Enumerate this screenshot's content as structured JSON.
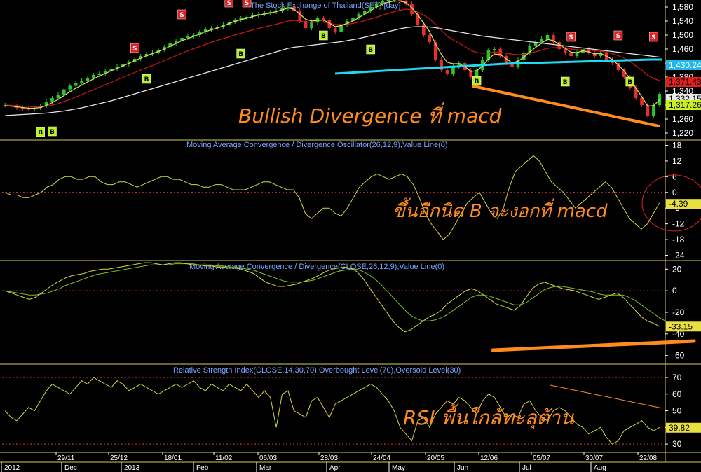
{
  "chart_data": [
    {
      "type": "candlestick",
      "title": "The Stock Exchange of Thailand(SET) [day]",
      "ylim": [
        1200,
        1600
      ],
      "yticks": [
        "1,580",
        "1,540",
        "1,500",
        "1,460",
        "1,420",
        "1,380",
        "1,340",
        "1,300",
        "1,260",
        "1,220"
      ],
      "price_badges": [
        {
          "value": "1,430.24",
          "color": "#20b8e8"
        },
        {
          "value": "1,371.43",
          "color": "#e02020"
        },
        {
          "value": "1,332.15",
          "color": "#e8e8e8"
        },
        {
          "value": "1,317.26",
          "color": "#c8f020"
        }
      ],
      "close": [
        1300,
        1296,
        1292,
        1290,
        1288,
        1292,
        1298,
        1310,
        1320,
        1330,
        1345,
        1355,
        1362,
        1370,
        1378,
        1386,
        1390,
        1396,
        1404,
        1410,
        1416,
        1424,
        1432,
        1440,
        1446,
        1450,
        1458,
        1466,
        1476,
        1484,
        1492,
        1496,
        1500,
        1508,
        1516,
        1520,
        1524,
        1530,
        1538,
        1544,
        1548,
        1552,
        1556,
        1560,
        1562,
        1566,
        1570,
        1576,
        1580,
        1570,
        1540,
        1520,
        1536,
        1548,
        1544,
        1520,
        1510,
        1530,
        1540,
        1548,
        1560,
        1570,
        1580,
        1590,
        1596,
        1600,
        1600,
        1598,
        1590,
        1560,
        1530,
        1500,
        1480,
        1430,
        1400,
        1390,
        1410,
        1420,
        1400,
        1380,
        1400,
        1430,
        1456,
        1460,
        1440,
        1420,
        1410,
        1430,
        1450,
        1470,
        1480,
        1490,
        1500,
        1480,
        1460,
        1450,
        1440,
        1450,
        1460,
        1450,
        1440,
        1450,
        1430,
        1420,
        1400,
        1380,
        1350,
        1320,
        1300,
        1270,
        1300,
        1332
      ],
      "ma_fast": [
        1298,
        1297,
        1295,
        1293,
        1291,
        1291,
        1293,
        1299,
        1307,
        1316,
        1327,
        1338,
        1348,
        1357,
        1366,
        1375,
        1383,
        1390,
        1398,
        1405,
        1412,
        1419,
        1427,
        1434,
        1441,
        1447,
        1453,
        1460,
        1468,
        1476,
        1484,
        1490,
        1496,
        1503,
        1510,
        1515,
        1520,
        1526,
        1533,
        1539,
        1544,
        1548,
        1553,
        1557,
        1560,
        1563,
        1567,
        1572,
        1577,
        1574,
        1560,
        1545,
        1540,
        1542,
        1543,
        1534,
        1524,
        1527,
        1533,
        1540,
        1550,
        1560,
        1570,
        1580,
        1588,
        1594,
        1597,
        1597,
        1593,
        1578,
        1558,
        1534,
        1510,
        1475,
        1445,
        1422,
        1418,
        1418,
        1410,
        1396,
        1398,
        1412,
        1432,
        1446,
        1444,
        1432,
        1421,
        1425,
        1437,
        1452,
        1465,
        1477,
        1488,
        1484,
        1473,
        1462,
        1451,
        1450,
        1455,
        1452,
        1446,
        1448,
        1440,
        1430,
        1415,
        1398,
        1375,
        1348,
        1324,
        1297,
        1298,
        1315
      ],
      "ma_mid": [
        1300,
        1299,
        1298,
        1297,
        1296,
        1295,
        1295,
        1297,
        1300,
        1304,
        1310,
        1316,
        1323,
        1330,
        1337,
        1344,
        1351,
        1358,
        1365,
        1372,
        1379,
        1386,
        1393,
        1400,
        1407,
        1413,
        1420,
        1427,
        1434,
        1441,
        1448,
        1455,
        1461,
        1467,
        1473,
        1479,
        1485,
        1490,
        1495,
        1500,
        1505,
        1510,
        1515,
        1519,
        1523,
        1527,
        1531,
        1535,
        1540,
        1542,
        1540,
        1537,
        1536,
        1537,
        1537,
        1534,
        1530,
        1530,
        1531,
        1533,
        1537,
        1541,
        1546,
        1551,
        1557,
        1562,
        1567,
        1571,
        1574,
        1572,
        1566,
        1557,
        1546,
        1531,
        1514,
        1497,
        1486,
        1477,
        1467,
        1456,
        1450,
        1448,
        1449,
        1452,
        1451,
        1448,
        1445,
        1444,
        1445,
        1448,
        1452,
        1457,
        1462,
        1464,
        1464,
        1462,
        1460,
        1458,
        1458,
        1457,
        1455,
        1454,
        1451,
        1447,
        1441,
        1434,
        1424,
        1412,
        1400,
        1385,
        1376,
        1370
      ],
      "ma_slow": [
        1270,
        1271,
        1272,
        1273,
        1274,
        1275,
        1276,
        1277,
        1279,
        1281,
        1283,
        1286,
        1289,
        1292,
        1296,
        1300,
        1304,
        1308,
        1312,
        1317,
        1322,
        1327,
        1332,
        1337,
        1342,
        1347,
        1352,
        1357,
        1362,
        1367,
        1372,
        1377,
        1382,
        1387,
        1392,
        1397,
        1402,
        1407,
        1412,
        1417,
        1422,
        1427,
        1432,
        1437,
        1442,
        1447,
        1452,
        1457,
        1462,
        1465,
        1467,
        1469,
        1471,
        1473,
        1475,
        1477,
        1479,
        1481,
        1484,
        1487,
        1490,
        1494,
        1498,
        1502,
        1506,
        1510,
        1514,
        1518,
        1521,
        1523,
        1524,
        1524,
        1523,
        1521,
        1518,
        1515,
        1512,
        1509,
        1506,
        1503,
        1500,
        1497,
        1495,
        1493,
        1491,
        1489,
        1487,
        1485,
        1483,
        1481,
        1479,
        1477,
        1475,
        1473,
        1471,
        1469,
        1467,
        1465,
        1463,
        1461,
        1459,
        1457,
        1455,
        1453,
        1451,
        1449,
        1447,
        1445,
        1443,
        1441,
        1439,
        1437
      ],
      "ma_cyan": [
        1390,
        1392,
        1394,
        1396,
        1398,
        1400,
        1402,
        1404,
        1406,
        1408,
        1410,
        1412,
        1414,
        1416,
        1418,
        1419,
        1420,
        1421,
        1422,
        1423,
        1424,
        1425,
        1426,
        1427,
        1428,
        1429,
        1430,
        1430
      ],
      "buy_signals": [
        "B",
        "B",
        "B",
        "B",
        "B",
        "B",
        "B",
        "B",
        "B"
      ],
      "sell_signals": [
        "S",
        "S",
        "S",
        "S",
        "S",
        "S",
        "S"
      ],
      "annotation": "Bullish Divergence ที่ macd"
    },
    {
      "type": "line",
      "title": "Moving Average Convergence / Divergence Oscillator(26,12,9),Value Line(0)",
      "ylim": [
        -26,
        20
      ],
      "yticks": [
        "18",
        "12",
        "6",
        "0",
        "-6",
        "-12",
        "-18",
        "-24"
      ],
      "value_badge": "-4.39",
      "values": [
        0,
        -1,
        -1,
        -2,
        -2,
        -1,
        0,
        2,
        3,
        5,
        6,
        6,
        5,
        5,
        6,
        6,
        4,
        3,
        3,
        4,
        4,
        3,
        2,
        3,
        4,
        5,
        6,
        6,
        5,
        5,
        4,
        3,
        3,
        2,
        2,
        3,
        3,
        2,
        1,
        1,
        1,
        2,
        3,
        4,
        4,
        3,
        2,
        1,
        1,
        -2,
        -8,
        -10,
        -8,
        -6,
        -6,
        -8,
        -9,
        -6,
        -2,
        2,
        4,
        6,
        7,
        6,
        5,
        6,
        7,
        6,
        3,
        -2,
        -8,
        -12,
        -15,
        -18,
        -16,
        -12,
        -8,
        -4,
        -2,
        0,
        -4,
        -8,
        -10,
        -6,
        2,
        8,
        10,
        12,
        14,
        12,
        8,
        4,
        2,
        0,
        -3,
        -6,
        -4,
        -2,
        0,
        2,
        4,
        2,
        -2,
        -6,
        -10,
        -12,
        -14,
        -12,
        -8,
        -4
      ],
      "annotation": "ขึ้นอีกนิด B จะงอกที่ macd"
    },
    {
      "type": "line",
      "title": "Moving Average Convergence / Divergence(CLOSE,26,12,9),Value Line(0)",
      "ylim": [
        -68,
        28
      ],
      "yticks": [
        "20",
        "0",
        "-20",
        "-40",
        "-60"
      ],
      "value_badge": "-33.15",
      "macd": [
        0,
        -2,
        -4,
        -6,
        -8,
        -6,
        -2,
        2,
        6,
        9,
        12,
        14,
        15,
        16,
        18,
        19,
        20,
        20,
        21,
        22,
        23,
        24,
        25,
        26,
        26,
        25,
        24,
        25,
        26,
        26,
        25,
        24,
        24,
        23,
        23,
        22,
        22,
        21,
        21,
        20,
        18,
        16,
        12,
        8,
        6,
        4,
        4,
        5,
        6,
        8,
        10,
        12,
        15,
        18,
        20,
        21,
        22,
        21,
        18,
        12,
        4,
        -4,
        -12,
        -20,
        -28,
        -34,
        -38,
        -36,
        -32,
        -28,
        -24,
        -22,
        -18,
        -12,
        -8,
        -4,
        0,
        2,
        0,
        -4,
        -8,
        -12,
        -14,
        -16,
        -18,
        -14,
        -6,
        2,
        6,
        8,
        6,
        4,
        2,
        1,
        0,
        -2,
        -4,
        -6,
        -8,
        -6,
        -4,
        -2,
        -6,
        -12,
        -18,
        -24,
        -28,
        -30,
        -33
      ],
      "signal": [
        0,
        -1,
        -2,
        -3,
        -4,
        -4,
        -3,
        -2,
        0,
        2,
        5,
        7,
        9,
        11,
        13,
        15,
        16,
        17,
        18,
        19,
        20,
        21,
        22,
        23,
        24,
        24,
        24,
        24,
        25,
        25,
        25,
        25,
        24,
        24,
        24,
        23,
        23,
        22,
        22,
        21,
        20,
        19,
        17,
        15,
        13,
        11,
        9,
        8,
        8,
        8,
        9,
        10,
        12,
        14,
        16,
        18,
        19,
        20,
        20,
        18,
        15,
        11,
        6,
        0,
        -6,
        -12,
        -18,
        -23,
        -26,
        -28,
        -28,
        -27,
        -25,
        -22,
        -18,
        -14,
        -10,
        -6,
        -4,
        -4,
        -5,
        -7,
        -9,
        -11,
        -13,
        -13,
        -11,
        -7,
        -3,
        1,
        3,
        4,
        4,
        3,
        2,
        1,
        0,
        -1,
        -3,
        -4,
        -4,
        -4,
        -4,
        -6,
        -9,
        -13,
        -17,
        -21,
        -25,
        -28,
        -31
      ],
      "zero_line": 0
    },
    {
      "type": "line",
      "title": "Relative Strength Index(CLOSE,14,30,70),Overbought Level(70),Oversold Level(30)",
      "ylim": [
        25,
        78
      ],
      "yticks": [
        "70",
        "60",
        "50",
        "40",
        "30"
      ],
      "value_badge": "39.82",
      "overbought": 70,
      "oversold": 30,
      "values": [
        50,
        46,
        44,
        48,
        52,
        50,
        56,
        62,
        66,
        64,
        62,
        60,
        64,
        68,
        66,
        70,
        68,
        66,
        64,
        68,
        66,
        62,
        64,
        66,
        64,
        62,
        60,
        62,
        64,
        66,
        64,
        66,
        68,
        64,
        62,
        66,
        64,
        62,
        66,
        64,
        62,
        66,
        62,
        58,
        62,
        58,
        40,
        60,
        62,
        50,
        48,
        46,
        56,
        58,
        52,
        46,
        54,
        56,
        58,
        60,
        62,
        64,
        66,
        64,
        60,
        56,
        50,
        40,
        36,
        32,
        44,
        46,
        40,
        48,
        52,
        56,
        54,
        58,
        56,
        52,
        48,
        56,
        60,
        58,
        52,
        46,
        48,
        46,
        54,
        56,
        50,
        46,
        44,
        50,
        52,
        50,
        46,
        42,
        40,
        36,
        38,
        40,
        34,
        30,
        32,
        38,
        40,
        42,
        44,
        40,
        38,
        40
      ],
      "annotation": "RSI พื้นใกล้ทะลุต้าน"
    }
  ],
  "x_axis": {
    "date_ticks": [
      "29/11",
      "25/12",
      "18/01",
      "11/02",
      "06/03",
      "28/03",
      "24/04",
      "20/05",
      "12/06",
      "05/07",
      "30/07",
      "22/08"
    ],
    "period_labels": [
      "2012",
      "Dec",
      "2013",
      "Feb",
      "Mar",
      "Apr",
      "May",
      "Jun",
      "Jul",
      "Aug"
    ]
  },
  "colors": {
    "background": "#000000",
    "pane_border": "#d9c75a",
    "price_candle_up": "#28c828",
    "price_candle_down": "#e03030",
    "ma_fast": "#e8e05a",
    "ma_mid": "#c81818",
    "ma_slow": "#e8e8e8",
    "ma_cyan": "#20d8f0",
    "indicator_line": "#d8d840",
    "signal_line": "#80c020",
    "annotation": "#ff8a1e",
    "level_line": "#e04040"
  }
}
